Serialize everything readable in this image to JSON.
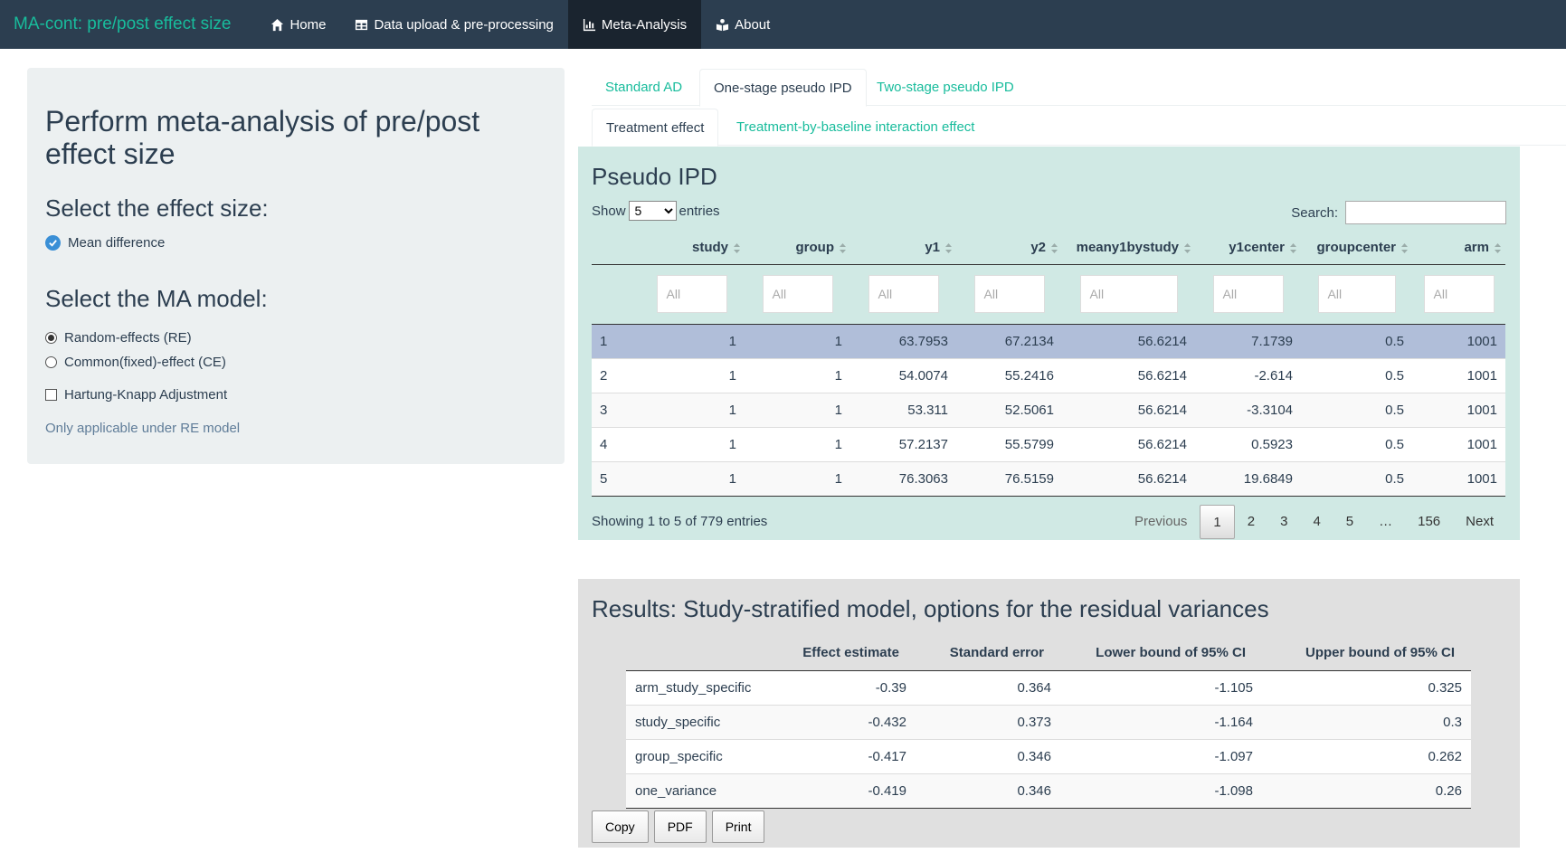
{
  "navbar": {
    "brand": "MA-cont: pre/post effect size",
    "items": [
      {
        "label": "Home",
        "icon": "home-icon"
      },
      {
        "label": "Data upload & pre-processing",
        "icon": "table-icon"
      },
      {
        "label": "Meta-Analysis",
        "icon": "bar-chart-icon",
        "active": true
      },
      {
        "label": "About",
        "icon": "book-reader-icon"
      }
    ]
  },
  "sidebar": {
    "title": "Perform meta-analysis of pre/post effect size",
    "effect_heading": "Select the effect size:",
    "effect_option": "Mean difference",
    "model_heading": "Select the MA model:",
    "model_options": [
      "Random-effects (RE)",
      "Common(fixed)-effect (CE)"
    ],
    "model_selected": "Random-effects (RE)",
    "hk_label": "Hartung-Knapp Adjustment",
    "hk_checked": false,
    "hk_help": "Only applicable under RE model"
  },
  "tabs": {
    "level1": [
      "Standard AD",
      "One-stage pseudo IPD",
      "Two-stage pseudo IPD"
    ],
    "level1_active": "One-stage pseudo IPD",
    "level2": [
      "Treatment effect",
      "Treatment-by-baseline interaction effect"
    ],
    "level2_active": "Treatment effect"
  },
  "pseudo_ipd": {
    "title": "Pseudo IPD",
    "show_label": "Show",
    "entries_value": "5",
    "entries_label": "entries",
    "search_label": "Search:",
    "columns": [
      "",
      "study",
      "group",
      "y1",
      "y2",
      "meany1bystudy",
      "y1center",
      "groupcenter",
      "arm"
    ],
    "filter_placeholders": [
      "",
      "All",
      "All",
      "All",
      "All",
      "All",
      "All",
      "All",
      "All"
    ],
    "rows": [
      [
        "1",
        "1",
        "1",
        "63.7953",
        "67.2134",
        "56.6214",
        "7.1739",
        "0.5",
        "1001"
      ],
      [
        "2",
        "1",
        "1",
        "54.0074",
        "55.2416",
        "56.6214",
        "-2.614",
        "0.5",
        "1001"
      ],
      [
        "3",
        "1",
        "1",
        "53.311",
        "52.5061",
        "56.6214",
        "-3.3104",
        "0.5",
        "1001"
      ],
      [
        "4",
        "1",
        "1",
        "57.2137",
        "55.5799",
        "56.6214",
        "0.5923",
        "0.5",
        "1001"
      ],
      [
        "5",
        "1",
        "1",
        "76.3063",
        "76.5159",
        "56.6214",
        "19.6849",
        "0.5",
        "1001"
      ]
    ],
    "info": "Showing 1 to 5 of 779 entries",
    "pagination": {
      "previous": "Previous",
      "pages": [
        "1",
        "2",
        "3",
        "4",
        "5",
        "…",
        "156"
      ],
      "current": "1",
      "next": "Next"
    }
  },
  "results": {
    "title": "Results: Study-stratified model, options for the residual variances",
    "columns": [
      "",
      "Effect estimate",
      "Standard error",
      "Lower bound of 95% CI",
      "Upper bound of 95% CI"
    ],
    "rows": [
      [
        "arm_study_specific",
        "-0.39",
        "0.364",
        "-1.105",
        "0.325"
      ],
      [
        "study_specific",
        "-0.432",
        "0.373",
        "-1.164",
        "0.3"
      ],
      [
        "group_specific",
        "-0.417",
        "0.346",
        "-1.097",
        "0.262"
      ],
      [
        "one_variance",
        "-0.419",
        "0.346",
        "-1.098",
        "0.26"
      ]
    ],
    "buttons": [
      "Copy",
      "PDF",
      "Print"
    ]
  }
}
